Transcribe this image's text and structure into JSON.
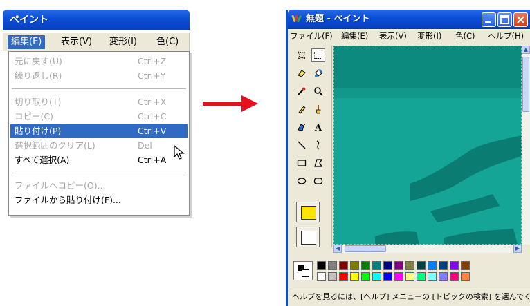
{
  "left_panel": {
    "title": "ペイント",
    "menubar": [
      "編集(E)",
      "表示(V)",
      "変形(I)",
      "色(C)"
    ],
    "edit_menu": [
      {
        "label": "元に戻す(U)",
        "shortcut": "Ctrl+Z",
        "state": "disabled"
      },
      {
        "label": "繰り返し(R)",
        "shortcut": "Ctrl+Y",
        "state": "disabled"
      },
      {
        "label": "切り取り(T)",
        "shortcut": "Ctrl+X",
        "state": "disabled"
      },
      {
        "label": "コピー(C)",
        "shortcut": "Ctrl+C",
        "state": "disabled"
      },
      {
        "label": "貼り付け(P)",
        "shortcut": "Ctrl+V",
        "state": "highlighted"
      },
      {
        "label": "選択範囲のクリア(L)",
        "shortcut": "Del",
        "state": "disabled"
      },
      {
        "label": "すべて選択(A)",
        "shortcut": "Ctrl+A",
        "state": "enabled"
      },
      {
        "label": "ファイルへコピー(O)...",
        "shortcut": "",
        "state": "disabled"
      },
      {
        "label": "ファイルから貼り付け(F)...",
        "shortcut": "",
        "state": "enabled"
      }
    ]
  },
  "arrow_color": "#e8101c",
  "paint_window": {
    "title": "無題 - ペイント",
    "menubar": [
      "ファイル(F)",
      "編集(E)",
      "表示(V)",
      "変形(I)",
      "色(C)",
      "ヘルプ(H)"
    ],
    "tools": [
      "free-select-icon",
      "rect-select-icon",
      "eraser-icon",
      "fill-icon",
      "eyedropper-icon",
      "magnifier-icon",
      "pencil-icon",
      "brush-icon",
      "airbrush-icon",
      "text-icon",
      "line-icon",
      "curve-icon",
      "rectangle-icon",
      "polygon-icon",
      "ellipse-icon",
      "rounded-rect-icon"
    ],
    "palette_top": [
      "#000000",
      "#808080",
      "#800000",
      "#808000",
      "#008000",
      "#008080",
      "#000080",
      "#800080",
      "#808040",
      "#004040",
      "#0080ff",
      "#004080",
      "#8000ff",
      "#804000"
    ],
    "palette_bottom": [
      "#ffffff",
      "#c0c0c0",
      "#ff0000",
      "#ffff00",
      "#00ff00",
      "#00ffff",
      "#0000ff",
      "#ff00ff",
      "#ffff80",
      "#00ff80",
      "#80ffff",
      "#8080ff",
      "#ff0080",
      "#ff8040"
    ],
    "canvas_color": "#0e9d8e",
    "status_text": "ヘルプを見るには、[ヘルプ] メニューの [トピックの検索] を選んでく"
  }
}
